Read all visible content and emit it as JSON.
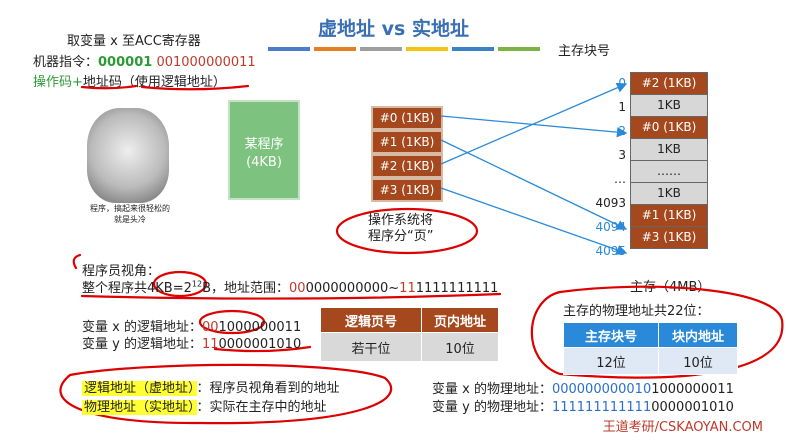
{
  "title": "虚地址 vs 实地址",
  "header_lines": {
    "line1": "取变量 x 至ACC寄存器",
    "instr_prefix": "机器指令：",
    "opcode": "000001",
    "address": "001000000011",
    "line3_a": "操作码+",
    "line3_b": "地址码",
    "line3_c": "（使用逻辑地址）"
  },
  "meme_caption": "程序，搞起来很轻松的\n就是头冷",
  "program_box": {
    "name": "某程序",
    "size": "(4KB)"
  },
  "pages": [
    "#0 (1KB)",
    "#1 (1KB)",
    "#2 (1KB)",
    "#3 (1KB)"
  ],
  "os_note": "操作系统将\n程序分“页”",
  "memory": {
    "header": "主存块号",
    "rows": [
      {
        "idx": "0",
        "label": "#2 (1KB)",
        "kind": "brown",
        "idx_color": "blue"
      },
      {
        "idx": "1",
        "label": "1KB",
        "kind": "gray",
        "idx_color": "black"
      },
      {
        "idx": "2",
        "label": "#0 (1KB)",
        "kind": "brown",
        "idx_color": "blue"
      },
      {
        "idx": "3",
        "label": "1KB",
        "kind": "gray",
        "idx_color": "black"
      },
      {
        "idx": "…",
        "label": "……",
        "kind": "gray",
        "idx_color": "black"
      },
      {
        "idx": "4093",
        "label": "1KB",
        "kind": "gray",
        "idx_color": "black"
      },
      {
        "idx": "4094",
        "label": "#1 (1KB)",
        "kind": "brown",
        "idx_color": "blue"
      },
      {
        "idx": "4095",
        "label": "#3 (1KB)",
        "kind": "brown",
        "idx_color": "blue"
      }
    ],
    "footer": "主存（4MB）"
  },
  "programmer_view": {
    "label": "程序员视角：",
    "line_a": "整个程序共",
    "size_expr": "4KB=2",
    "size_sup": "12",
    "size_unit": "B，地址范围：",
    "range_red1": "00",
    "range_mid": "0000000000~",
    "range_red2": "11",
    "range_end": "1111111111"
  },
  "logic_x": {
    "label": "变量 x 的逻辑地址：",
    "red": "00",
    "rest": "1000000011"
  },
  "logic_y": {
    "label": "变量 y 的逻辑地址：",
    "red": "11",
    "rest": "0000001010"
  },
  "logic_table": {
    "h1": "逻辑页号",
    "h2": "页内地址",
    "v1": "若干位",
    "v2": "10位"
  },
  "phys_note": "主存的物理地址共22位：",
  "phys_table": {
    "h1": "主存块号",
    "h2": "块内地址",
    "v1": "12位",
    "v2": "10位"
  },
  "defs": {
    "logical_term": "逻辑地址（虚地址）",
    "logical_desc": "：程序员视角看到的地址",
    "physical_term": "物理地址（实地址）",
    "physical_desc": "：实际在主存中的地址"
  },
  "phys_x": {
    "label": "变量 x 的物理地址：",
    "blue": "000000000010",
    "rest": "1000000011"
  },
  "phys_y": {
    "label": "变量 y 的物理地址：",
    "blue": "111111111111",
    "rest": "0000001010"
  },
  "footer": "王道考研/CSKAOYAN.COM",
  "colors": {
    "brown": "#a6481d",
    "title_blue": "#3a6fb4",
    "green": "#2e9a35",
    "table_blue": "#2a8ad9",
    "red": "#c0392b"
  }
}
